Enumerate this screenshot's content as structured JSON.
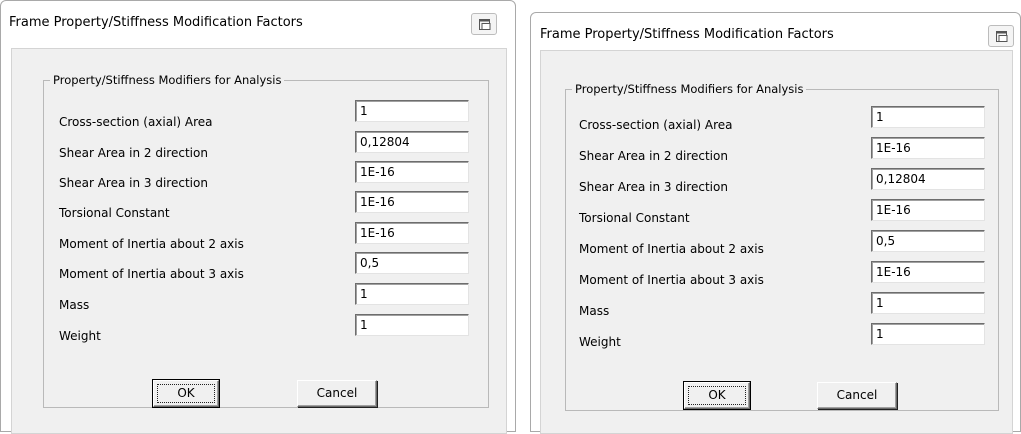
{
  "dialogs": [
    {
      "title": "Frame Property/Stiffness Modification Factors",
      "group_label": "Property/Stiffness Modifiers for Analysis",
      "fields": [
        {
          "label": "Cross-section (axial) Area",
          "value": "1"
        },
        {
          "label": "Shear Area in 2 direction",
          "value": "0,12804"
        },
        {
          "label": "Shear Area in 3 direction",
          "value": "1E-16"
        },
        {
          "label": "Torsional Constant",
          "value": "1E-16"
        },
        {
          "label": "Moment of Inertia about 2 axis",
          "value": "1E-16"
        },
        {
          "label": "Moment of Inertia about 3 axis",
          "value": "0,5"
        },
        {
          "label": "Mass",
          "value": "1"
        },
        {
          "label": "Weight",
          "value": "1"
        }
      ],
      "ok_label": "OK",
      "cancel_label": "Cancel",
      "sys_icon": "window-restore-icon"
    },
    {
      "title": "Frame Property/Stiffness Modification Factors",
      "group_label": "Property/Stiffness Modifiers for Analysis",
      "fields": [
        {
          "label": "Cross-section (axial) Area",
          "value": "1"
        },
        {
          "label": "Shear Area in 2 direction",
          "value": "1E-16"
        },
        {
          "label": "Shear Area in 3 direction",
          "value": "0,12804"
        },
        {
          "label": "Torsional Constant",
          "value": "1E-16"
        },
        {
          "label": "Moment of Inertia about 2 axis",
          "value": "0,5"
        },
        {
          "label": "Moment of Inertia about 3 axis",
          "value": "1E-16"
        },
        {
          "label": "Mass",
          "value": "1"
        },
        {
          "label": "Weight",
          "value": "1"
        }
      ],
      "ok_label": "OK",
      "cancel_label": "Cancel",
      "sys_icon": "window-restore-icon"
    }
  ]
}
